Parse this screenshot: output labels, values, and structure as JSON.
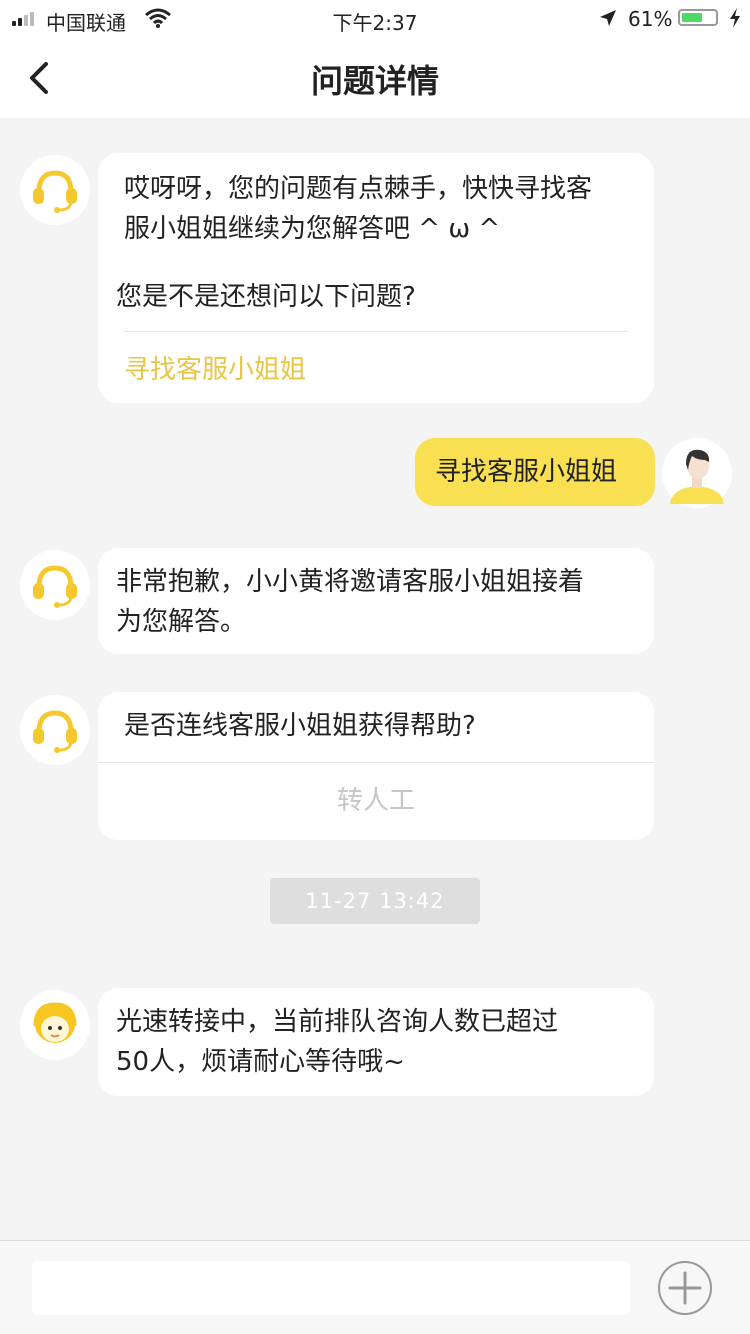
{
  "status_bar": {
    "carrier": "中国联通",
    "time": "下午2:37",
    "battery_percent": "61%",
    "battery_level": 0.61
  },
  "nav": {
    "title": "问题详情"
  },
  "messages": {
    "m1": {
      "line1": "哎呀呀，您的问题有点棘手，快快寻找客",
      "line2": "服小姐姐继续为您解答吧 ^ ω ^",
      "question": "您是不是还想问以下问题?",
      "link": "寻找客服小姐姐"
    },
    "m2": {
      "text": "寻找客服小姐姐"
    },
    "m3": {
      "line1": "非常抱歉，小小黄将邀请客服小姐姐接着",
      "line2": "为您解答。"
    },
    "m4": {
      "question": "是否连线客服小姐姐获得帮助?",
      "action": "转人工"
    },
    "timestamp": "11-27 13:42",
    "m5": {
      "line1": "光速转接中，当前排队咨询人数已超过",
      "line2": "50人，烦请耐心等待哦~"
    }
  },
  "input": {
    "value": "",
    "placeholder": ""
  },
  "colors": {
    "accent": "#f9df52",
    "link": "#e9c546",
    "background": "#f4f4f4"
  }
}
